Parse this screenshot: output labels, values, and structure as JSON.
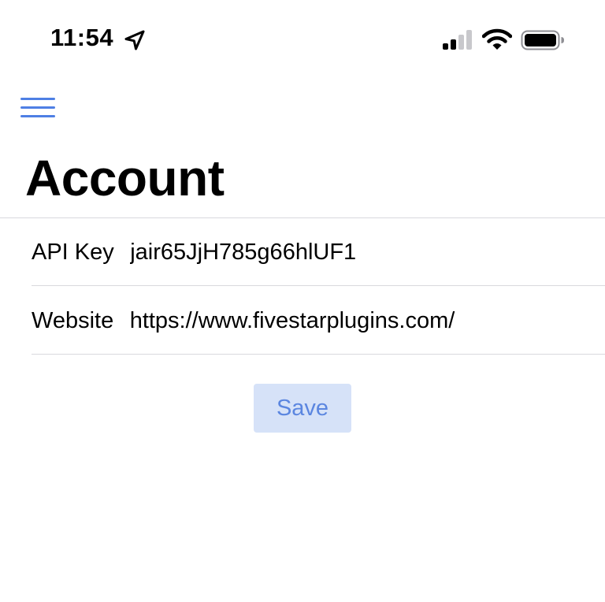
{
  "status_bar": {
    "time": "11:54",
    "icons": [
      "location-arrow-icon",
      "cellular-signal-icon",
      "wifi-icon",
      "battery-icon"
    ]
  },
  "nav": {
    "menu_icon": "hamburger-menu-icon",
    "accent_color": "#4e7fe4"
  },
  "page": {
    "title": "Account"
  },
  "form": {
    "fields": [
      {
        "label": "API Key",
        "value": "jair65JjH785g66hlUF1"
      },
      {
        "label": "Website",
        "value": "https://www.fivestarplugins.com/"
      }
    ],
    "save_label": "Save",
    "save_bg_color": "#d6e2f8",
    "save_text_color": "#5b86e0"
  }
}
